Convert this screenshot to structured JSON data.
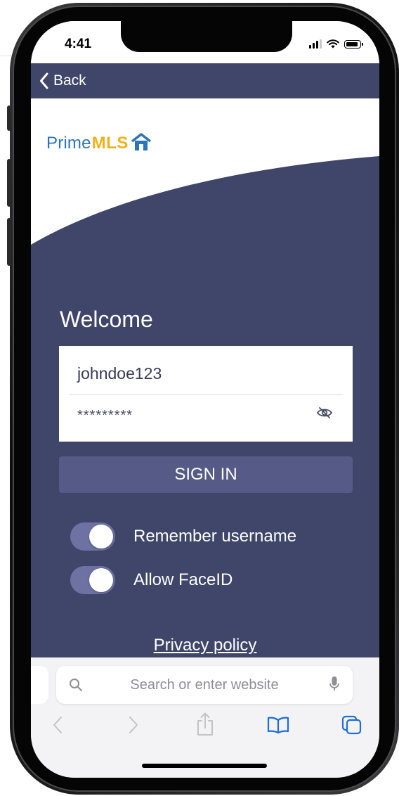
{
  "status_bar": {
    "time": "4:41"
  },
  "nav": {
    "back_label": "Back"
  },
  "logo": {
    "prime": "Prime",
    "mls": "MLS"
  },
  "login": {
    "welcome": "Welcome",
    "username_value": "johndoe123",
    "password_masked": "*********",
    "sign_in_label": "SIGN IN"
  },
  "options": {
    "remember_username": {
      "label": "Remember username",
      "enabled": true
    },
    "allow_faceid": {
      "label": "Allow FaceID",
      "enabled": true
    }
  },
  "footer": {
    "privacy_label": "Privacy policy"
  },
  "safari": {
    "address_placeholder": "Search or enter website"
  },
  "icons": [
    "back-chevron-icon",
    "eye-slash-icon",
    "search-icon",
    "microphone-icon",
    "back-arrow-icon",
    "forward-arrow-icon",
    "share-icon",
    "bookmarks-icon",
    "tabs-icon"
  ],
  "colors": {
    "nav_bar": "#3f4669",
    "panel": "#3f4669",
    "sign_in_button": "#555b86",
    "toggle_on": "#6d72a3",
    "logo_blue": "#2b74b8",
    "logo_yellow": "#f2b11c",
    "safari_accent": "#1e6ed8"
  }
}
